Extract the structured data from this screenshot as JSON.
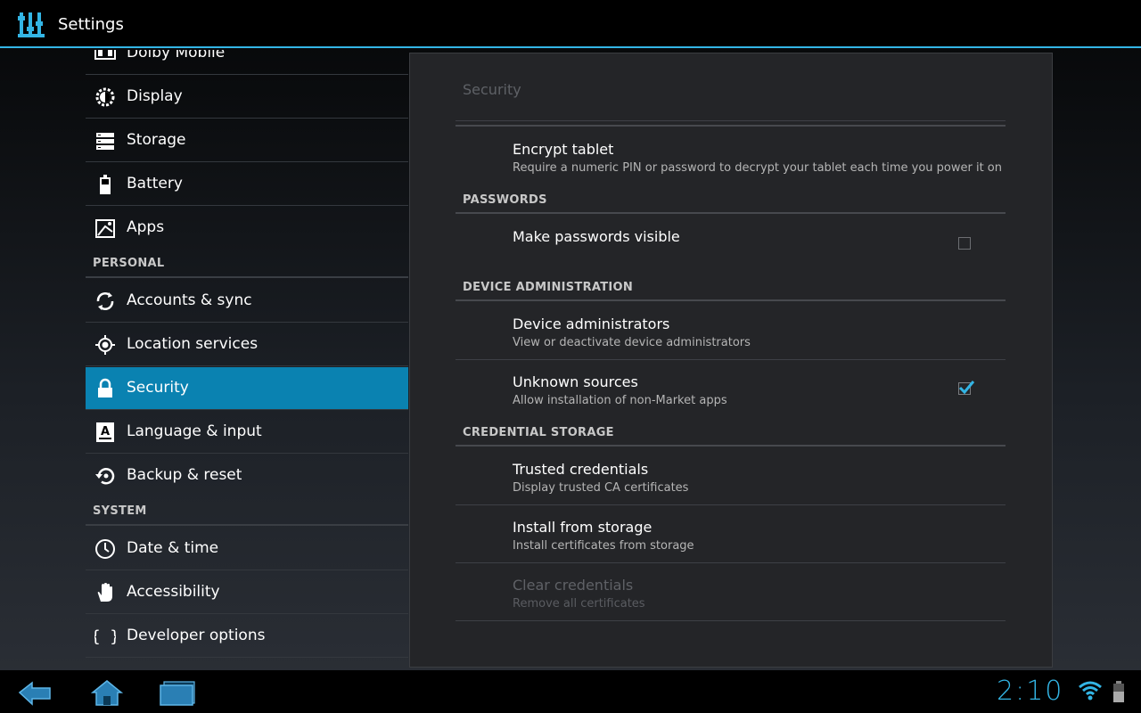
{
  "app": {
    "title": "Settings"
  },
  "sidebar": {
    "items": [
      {
        "label": "Dolby Mobile",
        "icon": "dolby-icon"
      },
      {
        "label": "Display",
        "icon": "brightness-icon"
      },
      {
        "label": "Storage",
        "icon": "storage-icon"
      },
      {
        "label": "Battery",
        "icon": "battery-icon"
      },
      {
        "label": "Apps",
        "icon": "apps-icon"
      },
      {
        "label": "Accounts & sync",
        "icon": "sync-icon"
      },
      {
        "label": "Location services",
        "icon": "location-icon"
      },
      {
        "label": "Security",
        "icon": "lock-icon",
        "selected": true
      },
      {
        "label": "Language & input",
        "icon": "keyboard-letter-icon"
      },
      {
        "label": "Backup & reset",
        "icon": "backup-icon"
      },
      {
        "label": "Date & time",
        "icon": "clock-icon"
      },
      {
        "label": "Accessibility",
        "icon": "hand-icon"
      },
      {
        "label": "Developer options",
        "icon": "braces-icon"
      }
    ],
    "headers": {
      "personal": "PERSONAL",
      "system": "SYSTEM"
    }
  },
  "panel": {
    "title": "Security",
    "encrypt": {
      "title": "Encrypt tablet",
      "summary": "Require a numeric PIN or password to decrypt your tablet each time you power it on"
    },
    "passwords": {
      "header": "PASSWORDS",
      "visible": {
        "title": "Make passwords visible",
        "checked": false
      }
    },
    "device_admin": {
      "header": "DEVICE ADMINISTRATION",
      "admins": {
        "title": "Device administrators",
        "summary": "View or deactivate device administrators"
      },
      "unknown": {
        "title": "Unknown sources",
        "summary": "Allow installation of non-Market apps",
        "checked": true
      }
    },
    "credentials": {
      "header": "CREDENTIAL STORAGE",
      "trusted": {
        "title": "Trusted credentials",
        "summary": "Display trusted CA certificates"
      },
      "install": {
        "title": "Install from storage",
        "summary": "Install certificates from storage"
      },
      "clear": {
        "title": "Clear credentials",
        "summary": "Remove all certificates",
        "enabled": false
      }
    }
  },
  "statusbar": {
    "time": "2:10"
  },
  "colors": {
    "accent": "#33b5e5",
    "selected": "#0a82b1",
    "panel": "#242528"
  }
}
